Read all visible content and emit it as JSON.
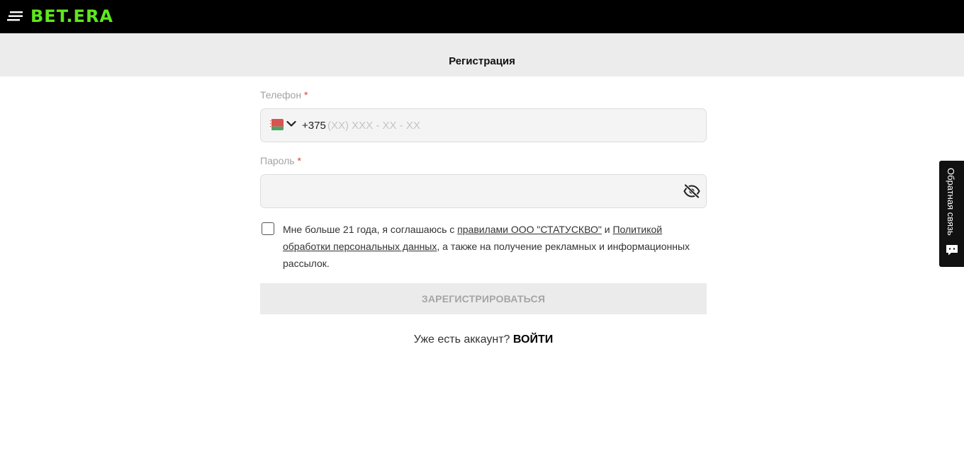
{
  "header": {
    "logo_main": "BET",
    "logo_dot": ".",
    "logo_tail": "ERA",
    "logo_color": "#5ee81c"
  },
  "page": {
    "title": "Регистрация"
  },
  "phone": {
    "label": "Телефон",
    "required_mark": "*",
    "country_code": "+375",
    "placeholder": "(XX) XXX - XX - XX",
    "value": "",
    "flag_icon": "belarus-flag-icon"
  },
  "password": {
    "label": "Пароль",
    "required_mark": "*",
    "value": "",
    "toggle_icon": "eye-off-icon"
  },
  "consent": {
    "text_before": "Мне больше 21 года, я соглашаюсь с ",
    "rules_link": "правилами ООО \"СТАТУСКВО\"",
    "text_middle": " и ",
    "policy_link": "Политикой обработки персональных данных",
    "text_after": ", а также на получение рекламных и информационных рассылок.",
    "checked": false
  },
  "submit": {
    "label": "ЗАРЕГИСТРИРОВАТЬСЯ"
  },
  "login": {
    "prompt": "Уже есть аккаунт?",
    "link": "ВОЙТИ"
  },
  "feedback": {
    "label": "Обратная связь"
  },
  "colors": {
    "accent_green": "#5ee81c",
    "required_red": "#e33d3d",
    "header_bg": "#000000"
  }
}
